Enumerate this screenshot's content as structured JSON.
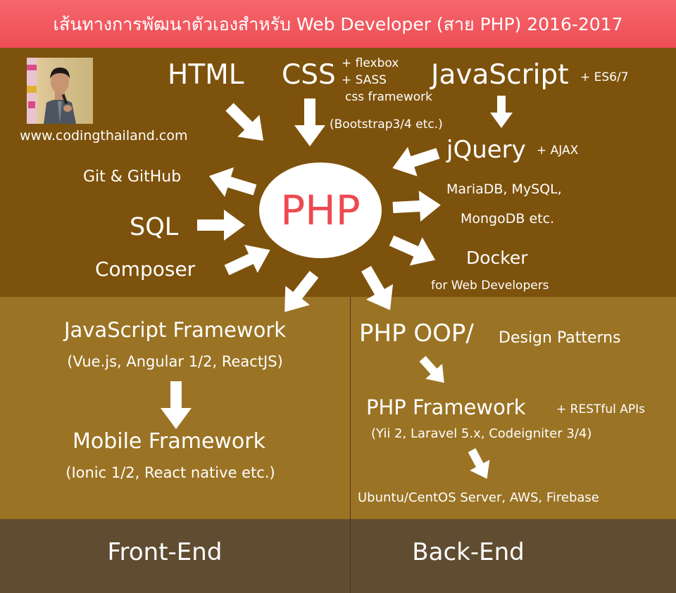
{
  "title": "เส้นทางการพัฒนาตัวเองสำหรับ Web Developer (สาย PHP) 2016-2017",
  "website": "www.codingthailand.com",
  "center": "PHP",
  "top": {
    "html": "HTML",
    "css": "CSS",
    "css_flexbox": "+ flexbox",
    "css_sass": "+ SASS",
    "css_framework": "css framework",
    "css_bootstrap": "(Bootstrap3/4 etc.)",
    "javascript": "JavaScript",
    "es": "+ ES6/7",
    "jquery": "jQuery",
    "ajax": "+ AJAX",
    "db_line1": "MariaDB, MySQL,",
    "db_line2": "MongoDB etc.",
    "docker": "Docker",
    "docker_sub": "for Web Developers",
    "git": "Git & GitHub",
    "sql": "SQL",
    "composer": "Composer"
  },
  "frontend": {
    "js_framework": "JavaScript Framework",
    "js_framework_list": "(Vue.js, Angular 1/2, ReactJS)",
    "mobile_framework": "Mobile Framework",
    "mobile_framework_list": "(Ionic 1/2, React native etc.)",
    "label": "Front-End"
  },
  "backend": {
    "oop": "PHP OOP/",
    "design_patterns": "Design Patterns",
    "php_framework": "PHP Framework",
    "restful": "+ RESTful APIs",
    "php_framework_list": "(Yii 2, Laravel 5.x, Codeigniter 3/4)",
    "servers": "Ubuntu/CentOS Server, AWS, Firebase",
    "label": "Back-End"
  },
  "colors": {
    "title_bg": "#ef4d55",
    "top_bg": "#7d520c",
    "middle_bg": "#9a7324",
    "bottom_bg": "#5f4c31",
    "php_text": "#ee4950"
  }
}
